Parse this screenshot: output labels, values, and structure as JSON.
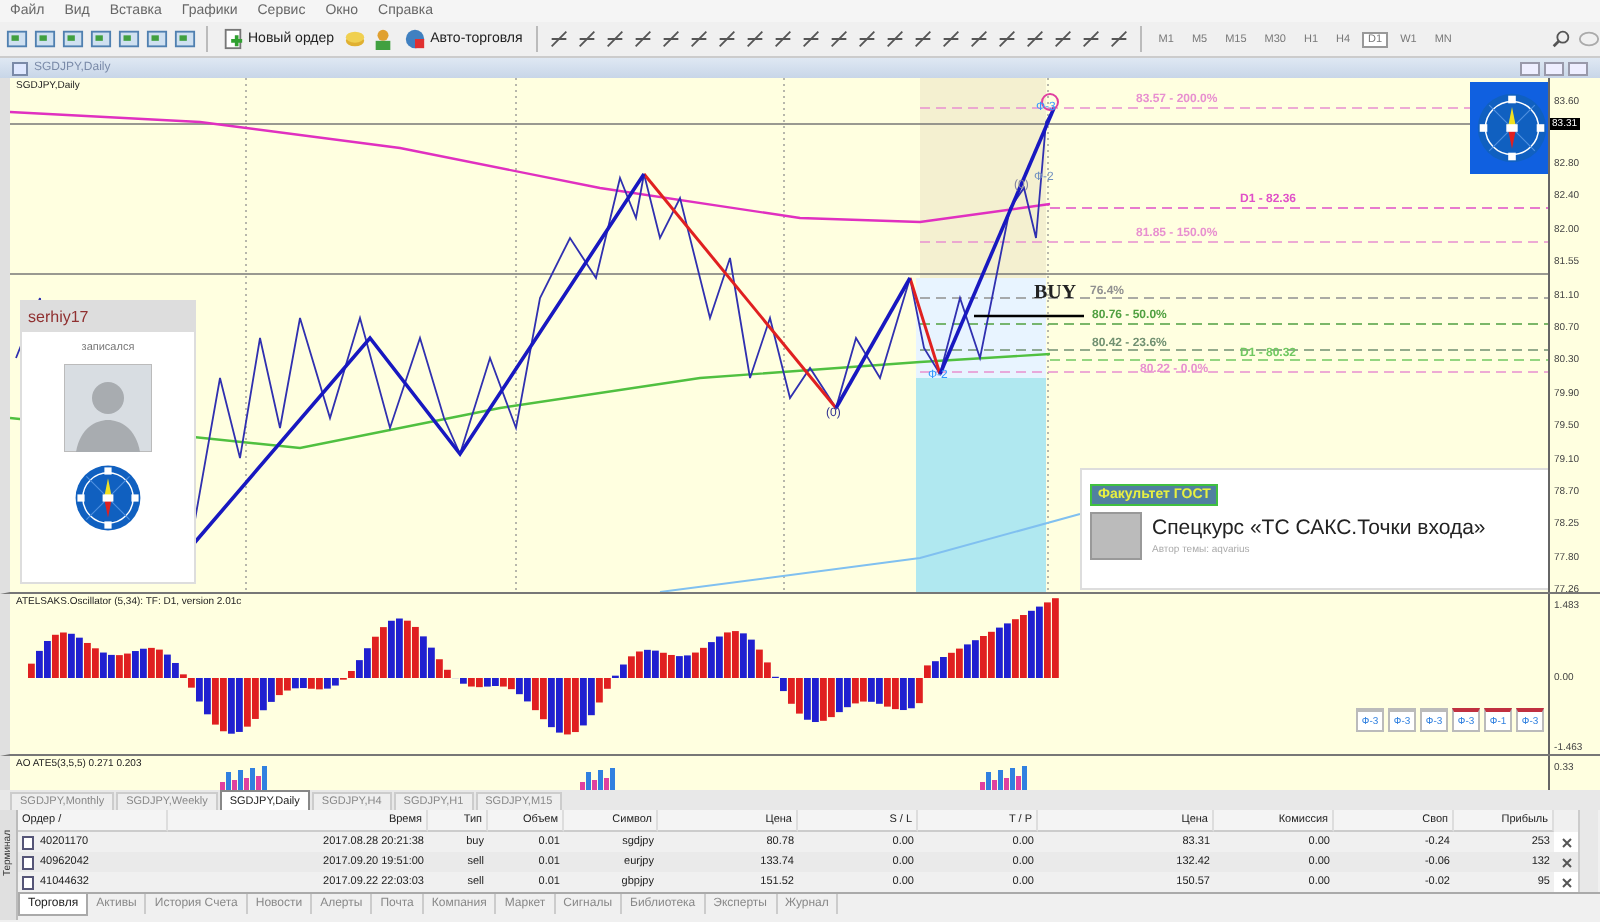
{
  "menu": [
    "Файл",
    "Вид",
    "Вставка",
    "Графики",
    "Сервис",
    "Окно",
    "Справка"
  ],
  "toolbar": {
    "new_order": "Новый ордер",
    "auto_trading": "Авто-торговля",
    "timeframes": [
      {
        "label": "M1",
        "selected": false
      },
      {
        "label": "M5",
        "selected": false
      },
      {
        "label": "M15",
        "selected": false
      },
      {
        "label": "M30",
        "selected": false
      },
      {
        "label": "H1",
        "selected": false
      },
      {
        "label": "H4",
        "selected": false
      },
      {
        "label": "D1",
        "selected": true
      },
      {
        "label": "W1",
        "selected": false
      },
      {
        "label": "MN",
        "selected": false
      }
    ]
  },
  "chart_window": {
    "title": "SGDJPY,Daily"
  },
  "main_chart": {
    "symbol_label": "SGDJPY,Daily",
    "current_price": "83.31",
    "price_axis": [
      "83.60",
      "82.80",
      "82.40",
      "82.00",
      "81.55",
      "81.10",
      "80.70",
      "80.30",
      "79.90",
      "79.50",
      "79.10",
      "78.70",
      "78.25",
      "77.80",
      "77.26"
    ],
    "level_labels": [
      {
        "text": "83.57 - 200.0%",
        "color": "#e890d0"
      },
      {
        "text": "D1 - 82.36",
        "color": "#e050c8"
      },
      {
        "text": "81.85 - 150.0%",
        "color": "#e890d0"
      },
      {
        "text": "76.4%",
        "color": "#909090"
      },
      {
        "text": "80.76 - 50.0%",
        "color": "#50a040"
      },
      {
        "text": "80.42 - 23.6%",
        "color": "#709070"
      },
      {
        "text": "D1 - 80.32",
        "color": "#70c860"
      },
      {
        "text": "80.22 - 0.0%",
        "color": "#e890d0"
      }
    ],
    "wave_labels": [
      {
        "text": "(0)",
        "color": "#303090"
      },
      {
        "text": "Ф-2",
        "color": "#3399ff"
      },
      {
        "text": "(0)",
        "color": "#8080a0"
      },
      {
        "text": "Ф-2",
        "color": "#7090c0"
      },
      {
        "text": "Ф-3",
        "color": "#3399ff"
      }
    ],
    "buy_label": "BUY",
    "user_card": {
      "name": "serhiy17",
      "status": "записался"
    },
    "ad": {
      "badge": "Факультет ГОСТ",
      "title": "Спецкурс «ТС САКС.Точки входа»",
      "author": "Автор темы: aqvarius"
    }
  },
  "oscillator": {
    "label": "ATELSAKS.Oscillator (5,34): TF: D1, version 2.01c",
    "axis": [
      "1.483",
      "0.00",
      "-1.463"
    ],
    "buttons": [
      {
        "label": "Ф-3",
        "highlighted": false
      },
      {
        "label": "Ф-3",
        "highlighted": false
      },
      {
        "label": "Ф-3",
        "highlighted": false
      },
      {
        "label": "Ф-3",
        "highlighted": true
      },
      {
        "label": "Ф-1",
        "highlighted": true
      },
      {
        "label": "Ф-3",
        "highlighted": true
      }
    ]
  },
  "ao": {
    "label": "AO ATE5(3,5,5) 0.271 0.203",
    "axis": [
      "0.33"
    ]
  },
  "chart_tabs": [
    {
      "label": "SGDJPY,Monthly",
      "selected": false
    },
    {
      "label": "SGDJPY,Weekly",
      "selected": false
    },
    {
      "label": "SGDJPY,Daily",
      "selected": true
    },
    {
      "label": "SGDJPY,H4",
      "selected": false
    },
    {
      "label": "SGDJPY,H1",
      "selected": false
    },
    {
      "label": "SGDJPY,M15",
      "selected": false
    }
  ],
  "terminal_label": "Терминал",
  "table": {
    "columns": [
      "Ордер /",
      "Время",
      "Тип",
      "Объем",
      "Символ",
      "Цена",
      "S / L",
      "T / P",
      "Цена",
      "Комиссия",
      "Своп",
      "Прибыль"
    ],
    "rows": [
      {
        "cells": [
          "40201170",
          "2017.08.28 20:21:38",
          "buy",
          "0.01",
          "sgdjpy",
          "80.78",
          "0.00",
          "0.00",
          "83.31",
          "0.00",
          "-0.24",
          "253"
        ]
      },
      {
        "cells": [
          "40962042",
          "2017.09.20 19:51:00",
          "sell",
          "0.01",
          "eurjpy",
          "133.74",
          "0.00",
          "0.00",
          "132.42",
          "0.00",
          "-0.06",
          "132"
        ]
      },
      {
        "cells": [
          "41044632",
          "2017.09.22 22:03:03",
          "sell",
          "0.01",
          "gbpjpy",
          "151.52",
          "0.00",
          "0.00",
          "150.57",
          "0.00",
          "-0.02",
          "95"
        ]
      }
    ]
  },
  "bottom_tabs": [
    {
      "label": "Торговля",
      "selected": true
    },
    {
      "label": "Активы",
      "selected": false
    },
    {
      "label": "История Счета",
      "selected": false
    },
    {
      "label": "Новости",
      "selected": false
    },
    {
      "label": "Алерты",
      "selected": false
    },
    {
      "label": "Почта",
      "selected": false
    },
    {
      "label": "Компания",
      "selected": false
    },
    {
      "label": "Маркет",
      "selected": false
    },
    {
      "label": "Сигналы",
      "selected": false
    },
    {
      "label": "Библиотека",
      "selected": false
    },
    {
      "label": "Эксперты",
      "selected": false
    },
    {
      "label": "Журнал",
      "selected": false
    }
  ]
}
